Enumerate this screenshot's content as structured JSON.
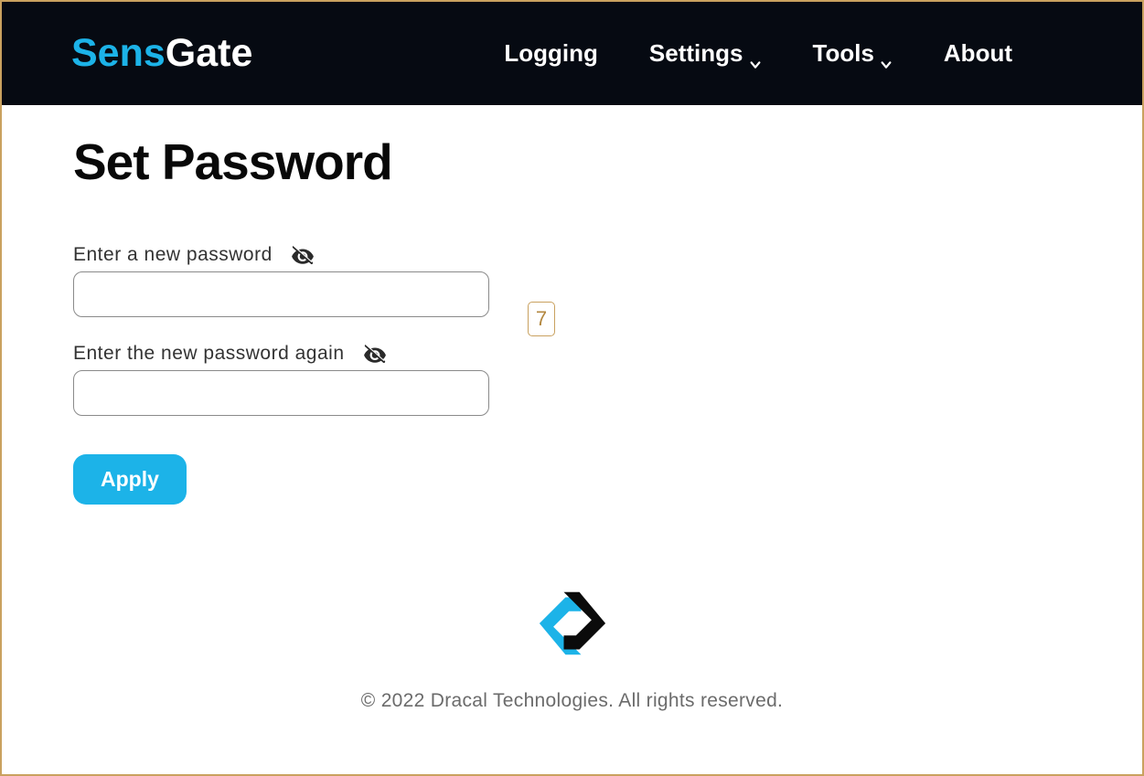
{
  "logo": {
    "part1": "Sens",
    "part2": "Gate"
  },
  "nav": {
    "logging": "Logging",
    "settings": "Settings",
    "tools": "Tools",
    "about": "About"
  },
  "page": {
    "title": "Set Password"
  },
  "form": {
    "password_label": "Enter a new password",
    "password_confirm_label": "Enter the new password again",
    "password_value": "",
    "password_confirm_value": "",
    "apply_label": "Apply"
  },
  "annotation": {
    "value": "7"
  },
  "footer": {
    "copyright": "© 2022 Dracal Technologies. All rights reserved."
  },
  "colors": {
    "accent": "#1cb3e8",
    "navbar_bg": "#060a12",
    "border": "#c9a15f"
  }
}
